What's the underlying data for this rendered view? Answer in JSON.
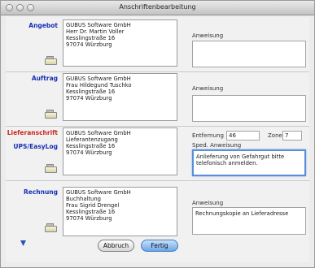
{
  "window": {
    "title": "Anschriftenbearbeitung"
  },
  "sections": [
    {
      "label": "Angebot",
      "address_lines": [
        "GUBUS Software GmbH",
        "Herr Dr. Martin Voller",
        "Kesslingstraße 16",
        "97074 Würzburg"
      ],
      "note_label": "Anweisung",
      "note_text": ""
    },
    {
      "label": "Auftrag",
      "address_lines": [
        "GUBUS Software GmbH",
        "Frau Hildegund Tuschko",
        "Kesslingstraße 16",
        "97074 Würzburg"
      ],
      "note_label": "Anweisung",
      "note_text": ""
    },
    {
      "label": "Lieferanschrift",
      "sublabel": "UPS/EasyLog",
      "address_lines": [
        "GUBUS Software GmbH",
        "Lieferantenzugang",
        "Kesslingstraße 16",
        "97074 Würzburg"
      ],
      "distance_label": "Entfernung",
      "distance_value": "46",
      "zone_label": "Zone",
      "zone_value": "7",
      "note_label": "Sped. Anweisung",
      "note_text": "Anlieferung von Gefahrgut bitte telefonisch anmelden."
    },
    {
      "label": "Rechnung",
      "address_lines": [
        "GUBUS Software GmbH",
        "Buchhaltung",
        "Frau Sigrid Drengel",
        "Kesslingstraße 16",
        "97074 Würzburg"
      ],
      "note_label": "Anweisung",
      "note_text": "Rechnungskopie an Lieferadresse"
    }
  ],
  "buttons": {
    "cancel": "Abbruch",
    "ok": "Fertig"
  },
  "icons": {
    "address_book": "address-card-icon",
    "help": "help-icon"
  }
}
